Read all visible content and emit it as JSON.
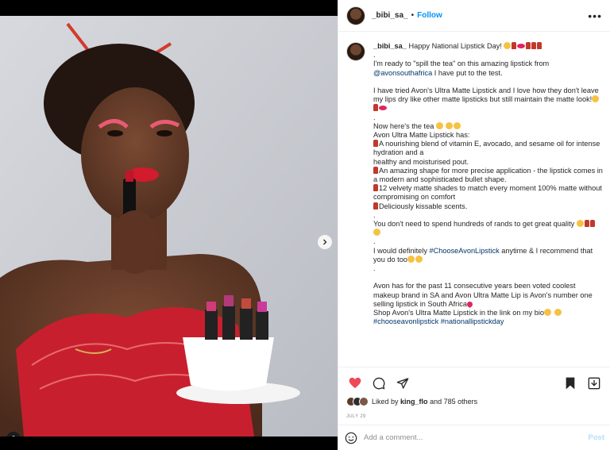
{
  "post": {
    "username": "_bibi_sa_",
    "follow_label": "Follow",
    "more_label": "•••"
  },
  "caption": {
    "username": "_bibi_sa_",
    "lines": [
      "Happy National Lipstick Day!",
      ".",
      "I'm ready to \"spill the tea\" on this amazing lipstick from",
      "@avonsouthafrica",
      "I have put to the test.",
      "I have tried Avon's Ultra Matte Lipstick and I love how they don't leave my lips dry like other matte lipsticks but still maintain the matte look!",
      ".",
      "Now here's the tea",
      "Avon Ultra Matte Lipstick has:",
      "A nourishing blend of vitamin E, avocado, and sesame oil for intense hydration and a",
      "healthy and moisturised pout.",
      "An amazing shape for more precise application - the lipstick comes in a modern and sophisticated bullet shape.",
      "12 velvety matte shades to match every moment 100% matte without compromising on comfort",
      "Deliciously kissable scents.",
      ".",
      "You don't need to spend hundreds of rands to get great quality",
      ".",
      "I would definitely",
      "#ChooseAvonLipstick",
      "anytime & I recommend that you do too",
      ".",
      "Avon has for the past 11 consecutive years been voted coolest makeup brand in SA and Avon Ultra Matte Lip is Avon's number one selling lipstick in South Africa",
      "Shop Avon's Ultra Matte Lipstick in the link on my bio",
      "#chooseavonlipstick",
      "#nationallipstickday"
    ]
  },
  "likes": {
    "prefix": "Liked by",
    "user": "king_flo",
    "suffix": "and 785 others"
  },
  "date": "JULY 29",
  "comment": {
    "placeholder": "Add a comment...",
    "post_label": "Post"
  },
  "carousel": {
    "slide_count": 5,
    "active_index": 0
  },
  "colors": {
    "link": "#00376b",
    "follow": "#0095f6",
    "like_heart": "#ed4956",
    "post_disabled": "#b2dffc"
  }
}
